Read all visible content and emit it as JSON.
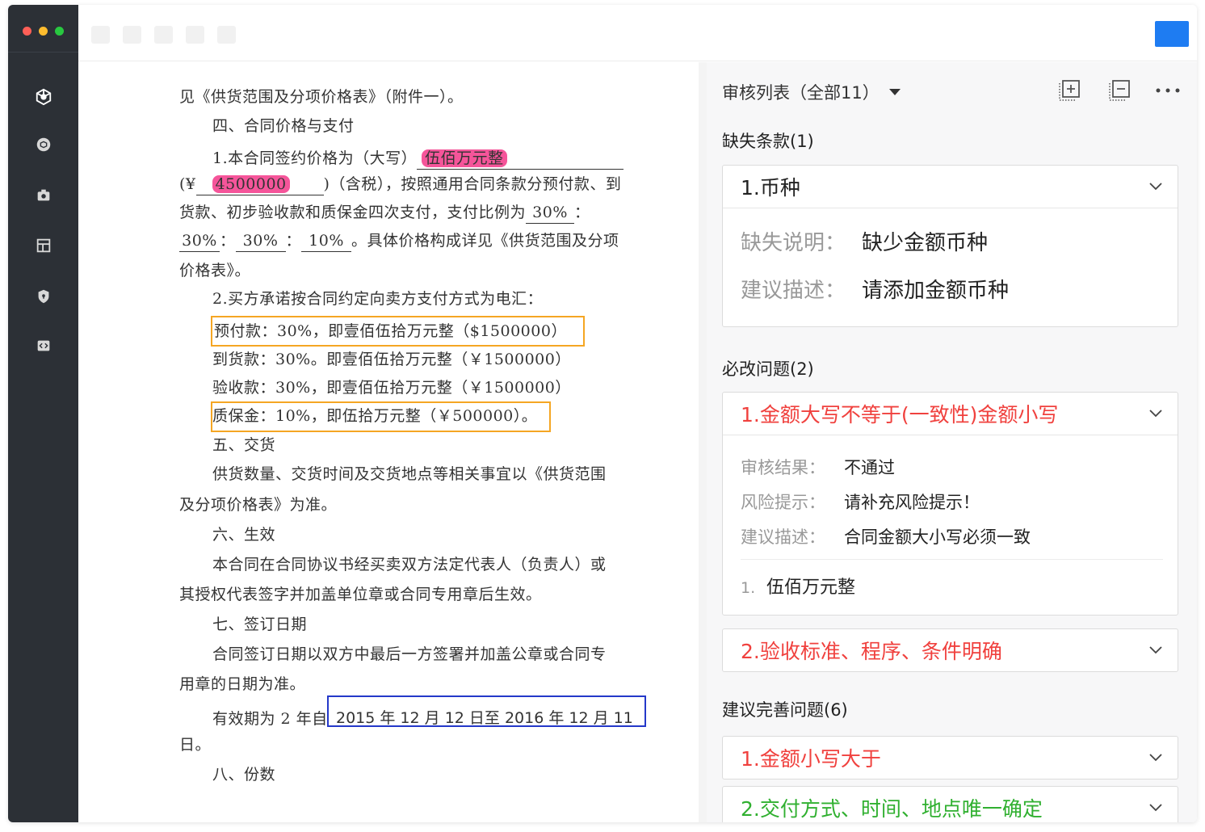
{
  "window": {
    "traffic_lights": [
      "#ff5f57",
      "#febc2e",
      "#28c840"
    ],
    "accent_color": "#1e7cf2"
  },
  "sidebar": {
    "icons": [
      "cluster-icon",
      "package-icon",
      "camera-icon",
      "layout-icon",
      "shield-icon",
      "code-icon"
    ]
  },
  "document": {
    "l1": "见《供货范围及分项价格表》（附件一）。",
    "l2": "四、合同价格与支付",
    "l3_pre": "1.本合同签约价格为（大写）",
    "l3_amount_cn": "伍佰万元整",
    "l4_pre": "(¥",
    "l4_amount": "4500000",
    "l4_post": ")（含税），按照通用合同条款分预付款、到",
    "l5_pre": "货款、初步验收款和质保金四次支付，支付比例为",
    "l5_ratio": "30%",
    "l5_post": "：",
    "l6_r1": "30%",
    "l6_sep1": "：",
    "l6_r2": "30%",
    "l6_sep2": "：",
    "l6_r3": "10%",
    "l6_post": "。具体价格构成详见《供货范围及分项",
    "l7": "价格表》。",
    "l8": "2.买方承诺按合同约定向卖方支付方式为电汇：",
    "l9": "预付款：30%，即壹佰伍拾万元整（$1500000）",
    "l10": "到货款：30%。即壹佰伍拾万元整（￥1500000）",
    "l11": "验收款：30%，即壹佰伍拾万元整（￥1500000）",
    "l12": "质保金：10%，即伍拾万元整（￥500000）。",
    "l13": "五、交货",
    "l14": "供货数量、交货时间及交货地点等相关事宜以《供货范围",
    "l15": "及分项价格表》为准。",
    "l16": "六、生效",
    "l17": "本合同在合同协议书经买卖双方法定代表人（负责人）或",
    "l18": "其授权代表签字并加盖单位章或合同专用章后生效。",
    "l19": "七、签订日期",
    "l20": "合同签订日期以双方中最后一方签署并加盖公章或合同专",
    "l21": "用章的日期为准。",
    "l22_pre": "有效期为 2 年自",
    "l22_dates": "2015 年 12 月 12 日至 2016 年 12 月 11",
    "l23": "日。",
    "l24": "八、份数"
  },
  "panel": {
    "title": "审核列表（全部11）",
    "missing": {
      "header": "缺失条款(1)",
      "item_title": "1.币种",
      "rows": [
        {
          "key": "缺失说明：",
          "value": "缺少金额币种"
        },
        {
          "key": "建议描述：",
          "value": "请添加金额币种"
        }
      ]
    },
    "must_fix": {
      "header": "必改问题(2)",
      "item1_title": "1.金额大写不等于(一致性)金额小写",
      "item1_rows": [
        {
          "key": "审核结果：",
          "value": "不通过"
        },
        {
          "key": "风险提示：",
          "value": "请补充风险提示！"
        },
        {
          "key": "建议描述：",
          "value": "合同金额大小写必须一致"
        }
      ],
      "item1_list_num": "1.",
      "item1_list_text": "伍佰万元整",
      "item2_title": "2.验收标准、程序、条件明确"
    },
    "suggest": {
      "header": "建议完善问题(6)",
      "item1_title": "1.金额小写大于",
      "item2_title": "2.交付方式、时间、地点唯一确定"
    },
    "colors": {
      "error": "#f0413e",
      "ok": "#30b030"
    }
  }
}
